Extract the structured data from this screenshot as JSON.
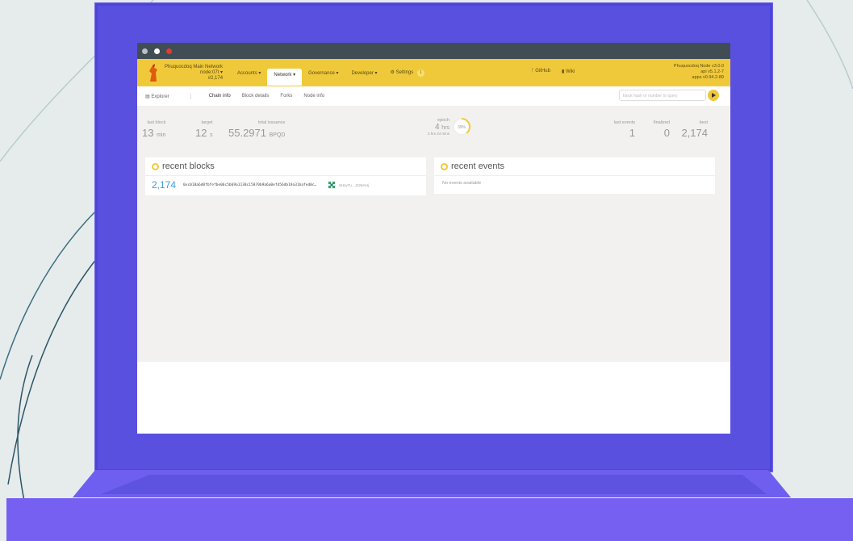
{
  "window": {
    "dot_colors": [
      "#b9bfc4",
      "#ffffff",
      "#e23b2f"
    ]
  },
  "app": {
    "chain_name": "Phuquocdoq Main Network",
    "node_name": "node:07t",
    "block_num": "#2,174",
    "menu": [
      {
        "label": "Accounts ▾",
        "active": false
      },
      {
        "label": "Network ▾",
        "active": true
      },
      {
        "label": "Governance ▾",
        "active": false
      },
      {
        "label": "Developer ▾",
        "active": false
      },
      {
        "label": "Settings",
        "active": false
      }
    ],
    "settings_badge": "1",
    "links": [
      "GitHub",
      "Wiki"
    ],
    "version_lines": [
      "Phuquocdoq Node v3.0.0",
      "api v5.1.2-7",
      "apps v0.94.2-89"
    ]
  },
  "subnav": {
    "section": "Explorer",
    "tabs": [
      "Chain info",
      "Block details",
      "Forks",
      "Node info"
    ],
    "active_tab": "Chain info",
    "search_placeholder": "block hash or number to query"
  },
  "summary": {
    "last_block": {
      "label": "last block",
      "value": "13",
      "unit": "min"
    },
    "target": {
      "label": "target",
      "value": "12",
      "unit": "s"
    },
    "total_issuance": {
      "label": "total issuance",
      "value": "55.2971",
      "unit": "BPQD"
    },
    "epoch": {
      "label": "epoch",
      "value": "4",
      "unit": "hrs",
      "remaining": "2 hrs 24 mins",
      "percent_text": "39%",
      "progress": 0.39
    },
    "last_events": {
      "label": "last events",
      "value": "1"
    },
    "finalized": {
      "label": "finalized",
      "value": "0"
    },
    "best": {
      "label": "best",
      "value": "2,174"
    }
  },
  "recent_blocks": {
    "title": "recent blocks",
    "rows": [
      {
        "number": "2,174",
        "hash": "0xc018a6d0fbfefbe06c5b69a1138c15870b9a6a0efd56db19a31bafed0c…",
        "author": "5Hov7u…Jzz6AHj"
      }
    ]
  },
  "recent_events": {
    "title": "recent events",
    "empty": "No events available"
  }
}
